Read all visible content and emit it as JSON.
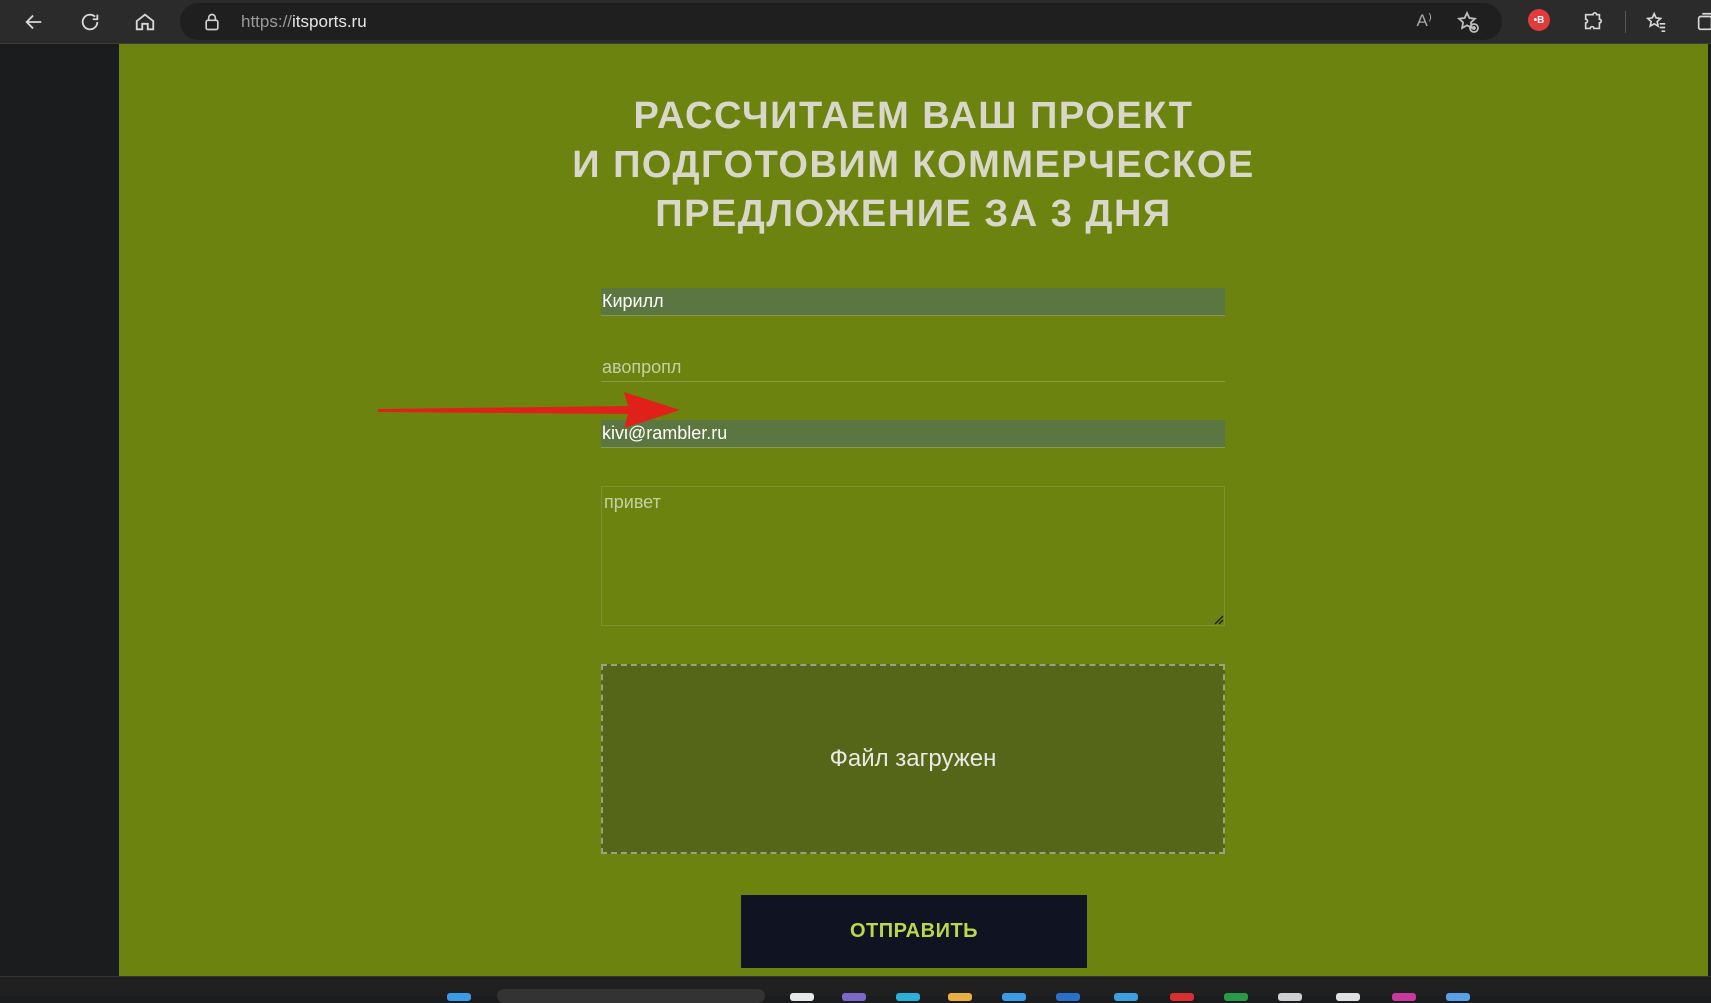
{
  "browser": {
    "url_protocol": "https://",
    "url_host": "itsports.ru",
    "read_aloud_label": "A⁾",
    "extension_badge": "•B"
  },
  "page": {
    "heading_lines": [
      "РАССЧИТАЕМ ВАШ ПРОЕКТ",
      "И ПОДГОТОВИМ КОММЕРЧЕСКОЕ",
      "ПРЕДЛОЖЕНИЕ ЗА 3 ДНЯ"
    ],
    "form": {
      "name_value": "Кирилл",
      "phone_value": "авопропл",
      "email_value": "kivi@rambler.ru",
      "message_value": "привет",
      "file_status": "Файл загружен",
      "submit_label": "ОТПРАВИТЬ"
    }
  },
  "colors": {
    "page_bg": "#6c830f",
    "heading": "#d9d7c9",
    "filled_field_bg": "#5c7641",
    "dropzone_bg": "#566619",
    "submit_bg": "#0f1322",
    "submit_text": "#b8d94a",
    "annotation_arrow": "#e0211a"
  }
}
